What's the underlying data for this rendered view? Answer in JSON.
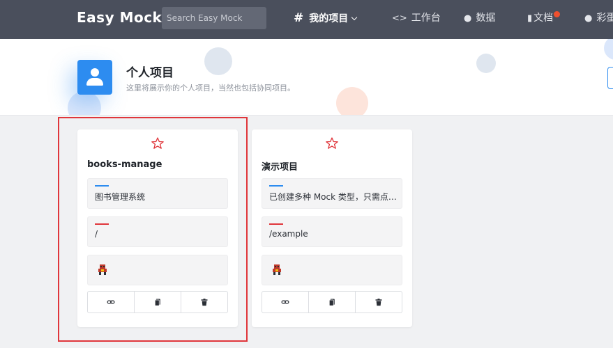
{
  "topbar": {
    "logo": "Easy Mock",
    "search_placeholder": "Search Easy Mock",
    "nav": {
      "my_projects": "我的项目",
      "workbench": "工作台",
      "data": "数据",
      "docs": "文档",
      "more": "彩蛋"
    }
  },
  "header": {
    "title": "个人项目",
    "subtitle": "这里将展示你的个人项目，当然也包括协同项目。"
  },
  "colors": {
    "accent": "#2d8cf0",
    "star": "#e0363b",
    "desc_bar": "#2d8cf0",
    "url_bar": "#e0363b"
  },
  "projects": [
    {
      "name": "books-manage",
      "description": "图书管理系统",
      "url": "/",
      "actions": [
        "link-icon",
        "copy-icon",
        "delete-icon"
      ]
    },
    {
      "name": "演示项目",
      "description": "已创建多种 Mock 类型，只需点击...",
      "url": "/example",
      "actions": [
        "link-icon",
        "copy-icon",
        "delete-icon"
      ]
    }
  ]
}
